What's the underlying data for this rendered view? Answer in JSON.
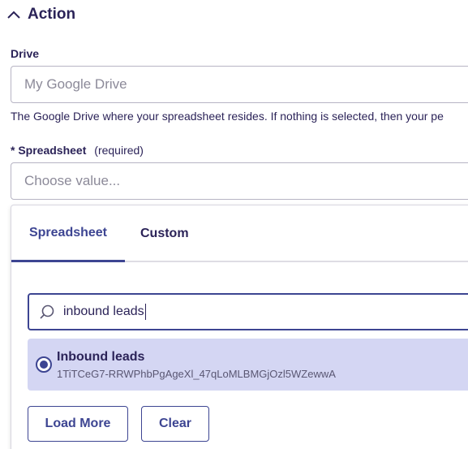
{
  "section": {
    "title": "Action",
    "icon": "chevron-up-icon"
  },
  "drive": {
    "label": "Drive",
    "placeholder": "My Google Drive",
    "help": "The Google Drive where your spreadsheet resides. If nothing is selected, then your pe"
  },
  "spreadsheet": {
    "asterisk": "*",
    "label": "Spreadsheet",
    "required": "(required)",
    "placeholder": "Choose value..."
  },
  "dropdown": {
    "tabs": [
      {
        "label": "Spreadsheet",
        "active": true
      },
      {
        "label": "Custom",
        "active": false
      }
    ],
    "search": {
      "value": "inbound leads",
      "icon": "search-icon"
    },
    "results": [
      {
        "title": "Inbound leads",
        "id": "1TiTCeG7-RRWPhbPgAgeXl_47qLoMLBMGjOzl5WZewwA",
        "selected": true
      }
    ],
    "buttons": {
      "load_more": "Load More",
      "clear": "Clear"
    }
  },
  "colors": {
    "accent": "#3d4592",
    "text": "#2b2358",
    "selected_bg": "#d4d6f3",
    "border": "#b7b4c4"
  }
}
